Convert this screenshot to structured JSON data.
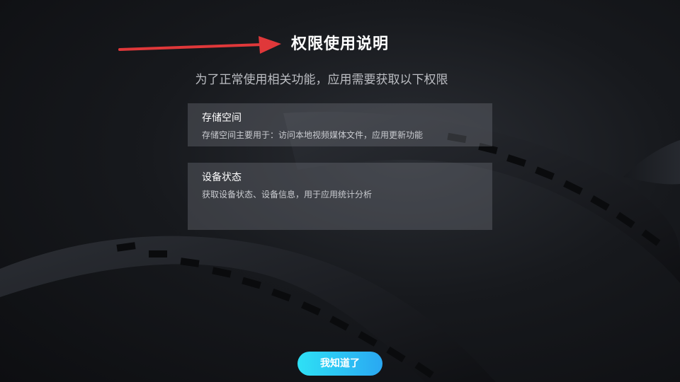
{
  "dialog": {
    "title": "权限使用说明",
    "subtitle": "为了正常使用相关功能，应用需要获取以下权限",
    "permissions": [
      {
        "title": "存储空间",
        "description": "存储空间主要用于：访问本地视频媒体文件，应用更新功能"
      },
      {
        "title": "设备状态",
        "description": "获取设备状态、设备信息，用于应用统计分析"
      }
    ],
    "confirm_label": "我知道了"
  },
  "colors": {
    "background": "#15171b",
    "card": "#5a5d64",
    "button_start": "#2ee0f5",
    "button_end": "#2aa8f2",
    "annotation_arrow": "#e0383a"
  },
  "icons": {
    "annotation": "red-arrow-icon"
  }
}
